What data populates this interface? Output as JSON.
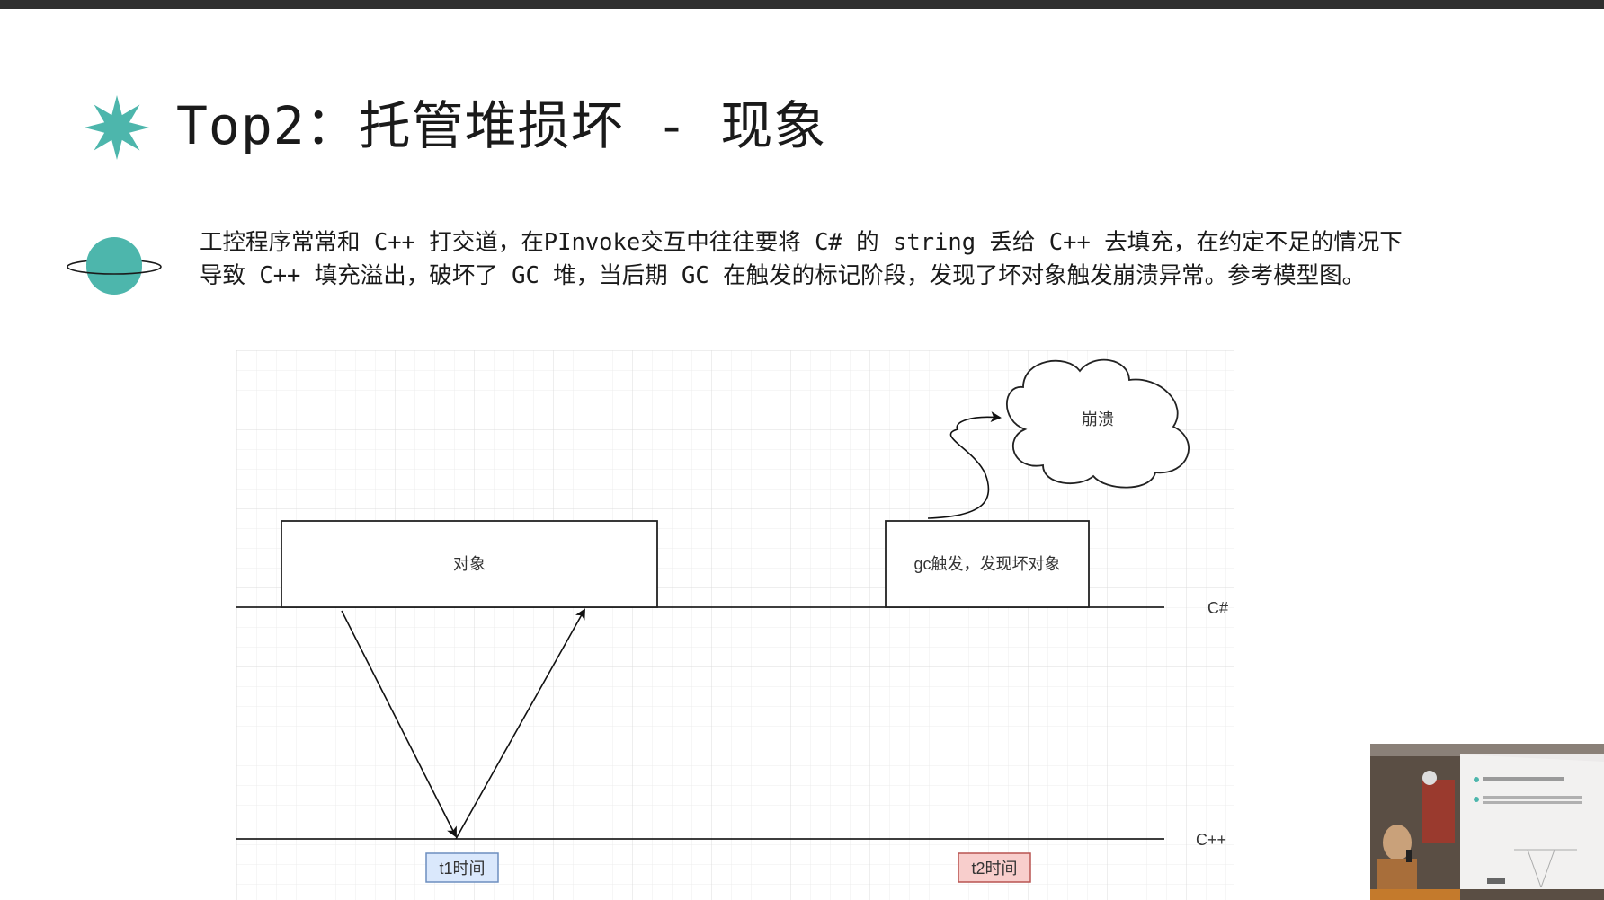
{
  "slide": {
    "title": "Top2：托管堆损坏 - 现象",
    "description": [
      "工控程序常常和 C++ 打交道，在PInvoke交互中往往要将 C# 的 string 丢给 C++ 去填充，在约定不足的情况下",
      "导致 C++ 填充溢出，破坏了 GC 堆，当后期 GC 在触发的标记阶段，发现了坏对象触发崩溃异常。参考模型图。"
    ]
  },
  "diagram": {
    "object_box_label": "对象",
    "gc_box_label": "gc触发，发现坏对象",
    "crash_cloud_label": "崩溃",
    "lane_csharp_label": "C#",
    "lane_cpp_label": "C++",
    "t1_label": "t1时间",
    "t2_label": "t2时间"
  },
  "colors": {
    "accent": "#4db6ac",
    "t1_fill": "#dae8fc",
    "t1_stroke": "#6c8ebf",
    "t2_fill": "#f8cecc",
    "t2_stroke": "#b85450"
  }
}
